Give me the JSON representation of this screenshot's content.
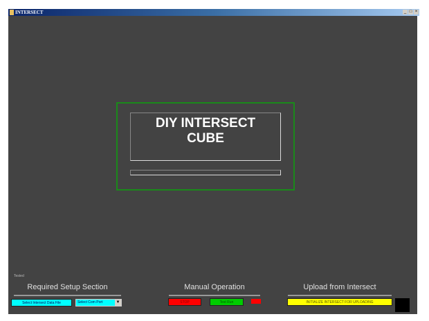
{
  "window": {
    "title": "INTERSECT",
    "minimize": "_",
    "maximize": "□",
    "close": "×"
  },
  "splash": {
    "line1": "DIY INTERSECT",
    "line2": "CUBE",
    "progress": 0
  },
  "status_label": "Tested",
  "setup": {
    "heading": "Required   Setup   Section",
    "select_file": "Select Intersect Data File",
    "com_port": "Select Com Port"
  },
  "manual": {
    "heading": "Manual Operation",
    "stop": "STOP",
    "test_run": "Test Run"
  },
  "upload": {
    "heading": "Upload from Intersect",
    "initialize": "INITIALIZE INTERSECT FOR UPLOADING"
  },
  "colors": {
    "stop": "#ff0000",
    "test_run": "#00cc00",
    "indicator": "#ff0000",
    "initialize": "#ffff00",
    "select_file": "#00ffff",
    "com_port": "#00ffff"
  }
}
